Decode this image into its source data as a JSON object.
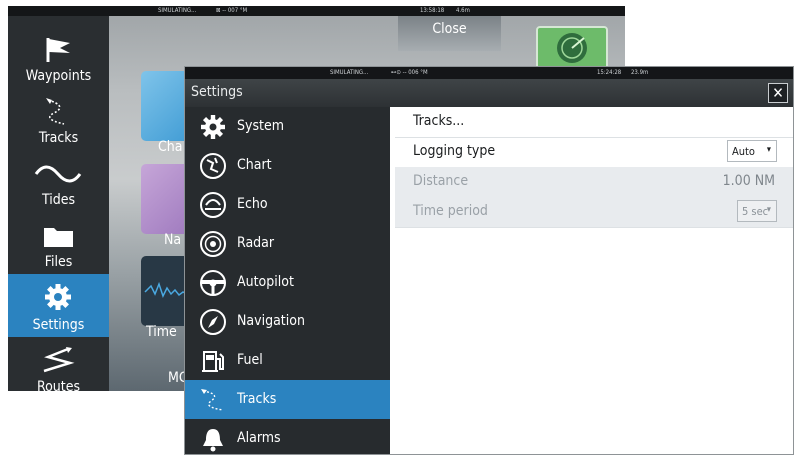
{
  "background_screen": {
    "status_bar": {
      "simulating": "SIMULATING...",
      "heading": "⊠ -- 007 °M",
      "clock": "13:58:18",
      "depth": "4.6m"
    },
    "sidebar": [
      {
        "label": "Waypoints",
        "icon": "flag-icon"
      },
      {
        "label": "Tracks",
        "icon": "track-icon"
      },
      {
        "label": "Tides",
        "icon": "tide-wave-icon"
      },
      {
        "label": "Files",
        "icon": "folder-icon"
      },
      {
        "label": "Settings",
        "icon": "gear-icon",
        "active": true
      },
      {
        "label": "Routes",
        "icon": "route-icon"
      }
    ],
    "tiles": [
      {
        "label": "Cha"
      },
      {
        "label": "Na"
      },
      {
        "label": "Time"
      },
      {
        "label": "MC"
      }
    ],
    "close_label": "Close"
  },
  "window": {
    "status_bar": {
      "simulating": "SIMULATING...",
      "heading": "⊷⊙ -- 006 °M",
      "clock": "15:24:28",
      "depth": "23.9m"
    },
    "title": "Settings",
    "close_icon_glyph": "✕",
    "menu": [
      {
        "label": "System",
        "icon": "gear-icon"
      },
      {
        "label": "Chart",
        "icon": "chart-icon"
      },
      {
        "label": "Echo",
        "icon": "echo-icon"
      },
      {
        "label": "Radar",
        "icon": "radar-icon"
      },
      {
        "label": "Autopilot",
        "icon": "steering-wheel-icon"
      },
      {
        "label": "Navigation",
        "icon": "compass-icon"
      },
      {
        "label": "Fuel",
        "icon": "fuel-pump-icon"
      },
      {
        "label": "Tracks",
        "icon": "track-icon",
        "active": true
      },
      {
        "label": "Alarms",
        "icon": "bell-icon"
      }
    ],
    "content": {
      "tracks_link": "Tracks...",
      "logging_type": {
        "label": "Logging type",
        "value": "Auto"
      },
      "distance": {
        "label": "Distance",
        "value": "1.00 NM"
      },
      "time_period": {
        "label": "Time period",
        "value": "5 sec"
      }
    }
  },
  "colors": {
    "accent": "#2b83c0",
    "menu_bg": "#272b2e",
    "disabled_row": "#e8ebee"
  }
}
